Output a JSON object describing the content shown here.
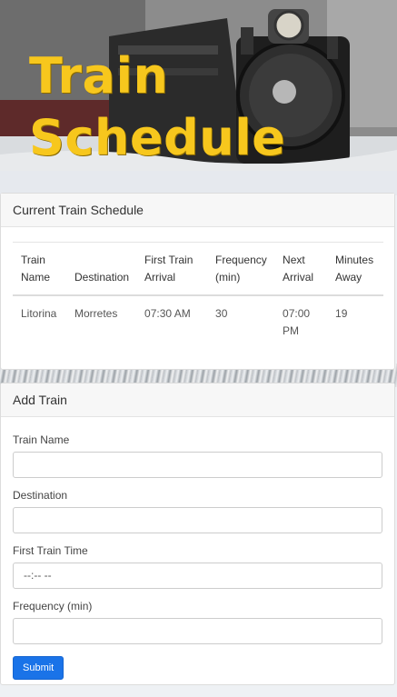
{
  "hero": {
    "title_line1": "Train",
    "title_line2": "Schedule",
    "title_color": "#f7c71d"
  },
  "schedule": {
    "header": "Current Train Schedule",
    "columns": [
      [
        "Train",
        "Name"
      ],
      [
        "Destination"
      ],
      [
        "First Train",
        "Arrival"
      ],
      [
        "Frequency",
        "(min)"
      ],
      [
        "Next",
        "Arrival"
      ],
      [
        "Minutes",
        "Away"
      ]
    ],
    "rows": [
      {
        "name": "Litorina",
        "destination": "Morretes",
        "first_arrival": "07:30 AM",
        "frequency": "30",
        "next_arrival_time": "07:00",
        "next_arrival_period": "PM",
        "minutes_away": "19"
      }
    ]
  },
  "add_train": {
    "header": "Add Train",
    "fields": {
      "name_label": "Train Name",
      "name_value": "",
      "destination_label": "Destination",
      "destination_value": "",
      "first_time_label": "First Train Time",
      "first_time_placeholder": "--:-- --",
      "frequency_label": "Frequency (min)",
      "frequency_value": ""
    },
    "submit_label": "Submit",
    "submit_color": "#1a73e8"
  }
}
